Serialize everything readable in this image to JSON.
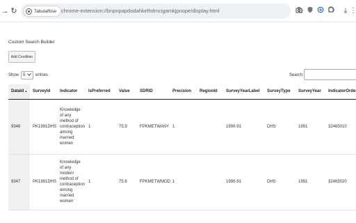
{
  "browser": {
    "back_icon": "→",
    "reload_icon": "↻",
    "site_name": "TabulaRise",
    "url": "chrome-extension://bnpnpapdodahkelhdmcigamkjpnope/display.html",
    "star_icon": "☆",
    "download_icon": "⤓",
    "menu_icon": "⋮"
  },
  "page": {
    "builder_title": "Custom Search Builder",
    "add_condition": "Add Condition",
    "show_label": "Show",
    "show_value": "5",
    "entries_label": "entries",
    "search_label": "Search:"
  },
  "table": {
    "columns": [
      "DataId",
      "SurveyId",
      "Indicator",
      "IsPreferred",
      "Value",
      "SDRID",
      "Precision",
      "RegionId",
      "SurveyYearLabel",
      "SurveyType",
      "SurveyYear",
      "IndicatorOrder"
    ],
    "sorted_column": "DataId",
    "rows": [
      {
        "DataId": "9346",
        "SurveyId": "PK1991DHS",
        "Indicator": [
          "Knowledge",
          "of any",
          "method of",
          "contraception",
          "among",
          "married",
          "women"
        ],
        "IsPreferred": "1",
        "Value": "75.9",
        "SDRID": "FPKMETWANY",
        "Precision": "1",
        "RegionId": "",
        "SurveyYearLabel": "1990-91",
        "SurveyType": "DHS",
        "SurveyYear": "1991",
        "IndicatorOrder": "32465010"
      },
      {
        "DataId": "9347",
        "SurveyId": "PK1991DHS",
        "Indicator": [
          "Knowledge",
          "of any",
          "modern",
          "method of",
          "contraception",
          "among",
          "married",
          "women"
        ],
        "IsPreferred": "1",
        "Value": "75.6",
        "SDRID": "FPKMETWMOD",
        "Precision": "1",
        "RegionId": "",
        "SurveyYearLabel": "1990-91",
        "SurveyType": "DHS",
        "SurveyYear": "1991",
        "IndicatorOrder": "32465020"
      }
    ]
  }
}
